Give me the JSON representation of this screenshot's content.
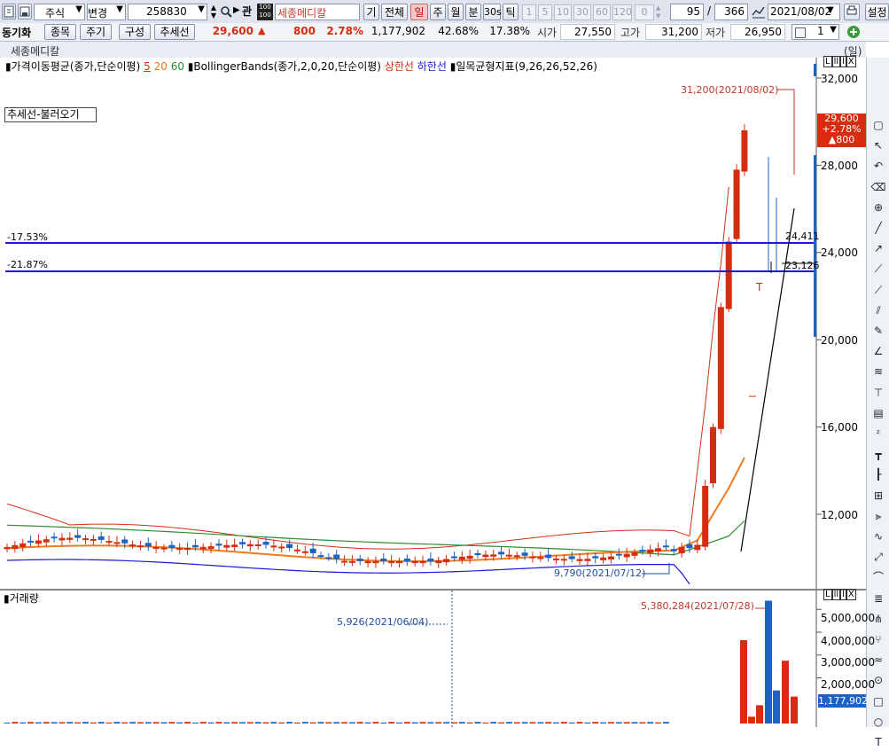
{
  "toolbar": {
    "market_type": "주식",
    "change_label": "변경",
    "code": "258830",
    "relation_label": "관",
    "icon_badge": "100",
    "stock_name": "세종메디칼",
    "period_tabs": [
      "기",
      "전체",
      "일",
      "주",
      "월",
      "분",
      "30s",
      "틱"
    ],
    "active_period": "일",
    "minute_options": [
      "1",
      "5",
      "10",
      "30",
      "60",
      "120"
    ],
    "zero_value": "0",
    "count_value": "95",
    "total_value": "366",
    "date_value": "2021/08/02",
    "settings_label": "설정"
  },
  "infobar": {
    "sync_label": "동기화",
    "item_button": "종목",
    "cycle_button": "주기",
    "layout_button": "구성",
    "trendline_button": "추세선",
    "price": "29,600",
    "up_arrow": "▲",
    "change": "800",
    "change_pct": "2.78%",
    "volume": "1,177,902",
    "ratio1": "42.68%",
    "ratio2": "17.38%",
    "open_label": "시가",
    "open": "27,550",
    "high_label": "고가",
    "high": "31,200",
    "low_label": "저가",
    "low": "26,950",
    "spinner_value": "1"
  },
  "chart": {
    "title": "세종메디칼",
    "unit": "(일)",
    "legend_ma_prefix": "가격이동평균(종가,단순이평)",
    "legend_ma": [
      "5",
      "20",
      "60"
    ],
    "legend_bb": "BollingerBands(종가,2,0,20,단순이평)",
    "legend_upper": "상한선",
    "legend_lower": "하한선",
    "legend_ichimoku": "일목균형지표(9,26,26,52,26)",
    "trend_load_label": "추세선-불러오기",
    "price_axis": [
      "32,000",
      "28,000",
      "24,000",
      "20,000",
      "16,000",
      "12,000"
    ],
    "hline1_pct": "-17.53%",
    "hline1_value": "24,411",
    "hline2_pct": "-21.87%",
    "hline2_value": "23,126",
    "high_annotation": "31,200(2021/08/02)",
    "low_annotation": "9,790(2021/07/12)",
    "current_price_tag": [
      "29,600",
      "+2.78%",
      "▲800"
    ],
    "t_marker": "T",
    "pane_buttons": [
      "L",
      "l",
      "ll",
      "X"
    ]
  },
  "volume_pane": {
    "title": "거래량",
    "axis": [
      "5,000,000",
      "4,000,000",
      "3,000,000",
      "2,000,000"
    ],
    "max_annotation": "5,380,284(2021/07/28)",
    "min_annotation": "5,926(2021/06/04)",
    "current_tag": "1,177,902"
  },
  "colors": {
    "up": "#d62d10",
    "down": "#1e63c4",
    "ma5": "#d62d10",
    "ma20": "#f07a1c",
    "ma60": "#2a8f2a",
    "bb_upper": "#d62d10",
    "bb_lower": "#1a1ad0",
    "hline": "#1a1ad0"
  },
  "right_tools": [
    "cursor-icon",
    "crosshair-icon",
    "undo-icon",
    "eraser-icon",
    "magnet-icon",
    "line-icon",
    "ray-icon",
    "extended-line-icon",
    "trend-line-icon",
    "parallel-icon",
    "pencil-icon",
    "angle-icon",
    "channel-icon",
    "vertical-line-icon",
    "box-icon",
    "zigzag-icon",
    "fibo-icon",
    "fibo-time-icon",
    "gann-icon",
    "speed-icon",
    "wave-icon",
    "fan-icon",
    "arc-icon",
    "cycle-icon",
    "pitchfork-icon",
    "andrews-icon",
    "regression-icon",
    "ellipse-icon",
    "rect-icon",
    "circle-icon",
    "text-icon"
  ]
}
